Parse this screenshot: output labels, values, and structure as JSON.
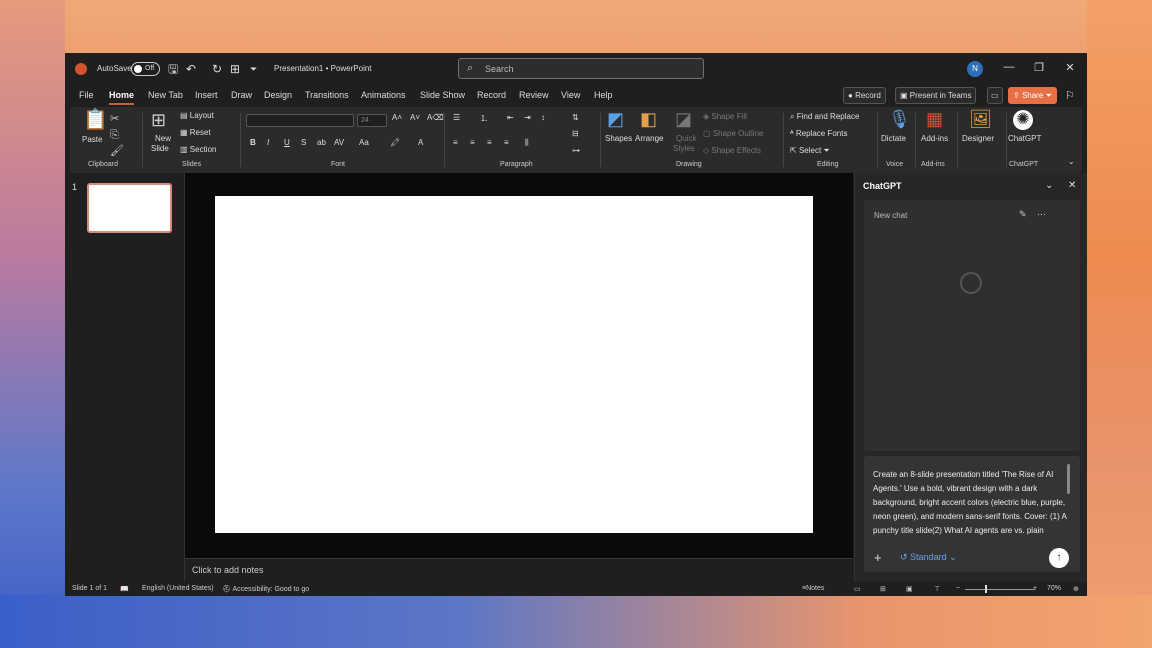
{
  "titlebar": {
    "autosave_label": "AutoSave",
    "autosave_state": "Off",
    "doc_title": "Presentation1 • PowerPoint",
    "search_placeholder": "Search",
    "avatar_initial": "N"
  },
  "menu": {
    "tabs": [
      "File",
      "Home",
      "New Tab",
      "Insert",
      "Draw",
      "Design",
      "Transitions",
      "Animations",
      "Slide Show",
      "Record",
      "Review",
      "View",
      "Help"
    ],
    "active_tab": "Home",
    "record_label": "Record",
    "present_teams_label": "Present in Teams",
    "share_label": "Share"
  },
  "ribbon": {
    "clipboard": {
      "paste": "Paste",
      "label": "Clipboard"
    },
    "slides": {
      "new_slide_1": "New",
      "new_slide_2": "Slide",
      "layout": "Layout",
      "reset": "Reset",
      "section": "Section",
      "label": "Slides"
    },
    "font": {
      "size": "24",
      "label": "Font",
      "bold": "B",
      "italic": "I",
      "underline": "U",
      "strike": "S",
      "aa": "Aa"
    },
    "paragraph": {
      "label": "Paragraph"
    },
    "drawing": {
      "shapes": "Shapes",
      "arrange": "Arrange",
      "quick_styles_1": "Quick",
      "quick_styles_2": "Styles",
      "shape_fill": "Shape Fill",
      "shape_outline": "Shape Outline",
      "shape_effects": "Shape Effects",
      "label": "Drawing"
    },
    "editing": {
      "find_replace": "Find and Replace",
      "replace_fonts": "Replace Fonts",
      "select": "Select",
      "label": "Editing"
    },
    "voice": {
      "dictate": "Dictate",
      "label": "Voice"
    },
    "addins": {
      "addins": "Add-ins",
      "label": "Add-ins"
    },
    "designer": {
      "designer": "Designer"
    },
    "chatgpt": {
      "chatgpt": "ChatGPT",
      "label": "ChatGPT"
    }
  },
  "thumbnails": {
    "slide_number": "1"
  },
  "notes": {
    "placeholder": "Click to add notes"
  },
  "chatgpt_pane": {
    "title": "ChatGPT",
    "new_chat": "New chat",
    "prompt": "Create an 8-slide presentation titled 'The Rise of AI Agents.' Use a bold, vibrant design with a dark background, bright accent colors (electric blue, purple, neon green), and modern sans-serif fonts. Cover: (1) A punchy title slide(2) What AI agents are vs. plain",
    "model": "Standard"
  },
  "statusbar": {
    "slide_of": "Slide 1 of 1",
    "language": "English (United States)",
    "accessibility": "Accessibility: Good to go",
    "notes": "Notes",
    "zoom": "70%"
  },
  "colors": {
    "accent": "#ca5d3c",
    "share": "#e86f45",
    "model_link": "#6ea0e8"
  }
}
